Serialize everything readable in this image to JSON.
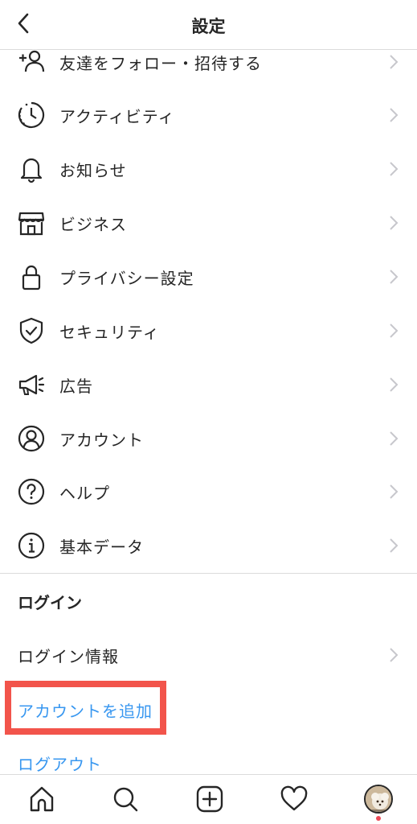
{
  "header": {
    "title": "設定",
    "back_icon": "chevron-left-icon"
  },
  "menu": [
    {
      "label": "友達をフォロー・招待する",
      "icon": "add-user-icon"
    },
    {
      "label": "アクティビティ",
      "icon": "activity-clock-icon"
    },
    {
      "label": "お知らせ",
      "icon": "bell-icon"
    },
    {
      "label": "ビジネス",
      "icon": "shop-icon"
    },
    {
      "label": "プライバシー設定",
      "icon": "lock-icon"
    },
    {
      "label": "セキュリティ",
      "icon": "shield-check-icon"
    },
    {
      "label": "広告",
      "icon": "megaphone-icon"
    },
    {
      "label": "アカウント",
      "icon": "user-circle-icon"
    },
    {
      "label": "ヘルプ",
      "icon": "help-icon"
    },
    {
      "label": "基本データ",
      "icon": "info-icon"
    }
  ],
  "login": {
    "section_title": "ログイン",
    "login_info": "ログイン情報",
    "add_account": "アカウントを追加",
    "logout": "ログアウト"
  },
  "colors": {
    "link": "#3897f0",
    "highlight": "#f2544b",
    "text": "#262626",
    "divider": "#dbdbdb"
  },
  "tabbar": [
    "home-icon",
    "search-icon",
    "new-post-icon",
    "heart-icon",
    "profile-avatar"
  ]
}
